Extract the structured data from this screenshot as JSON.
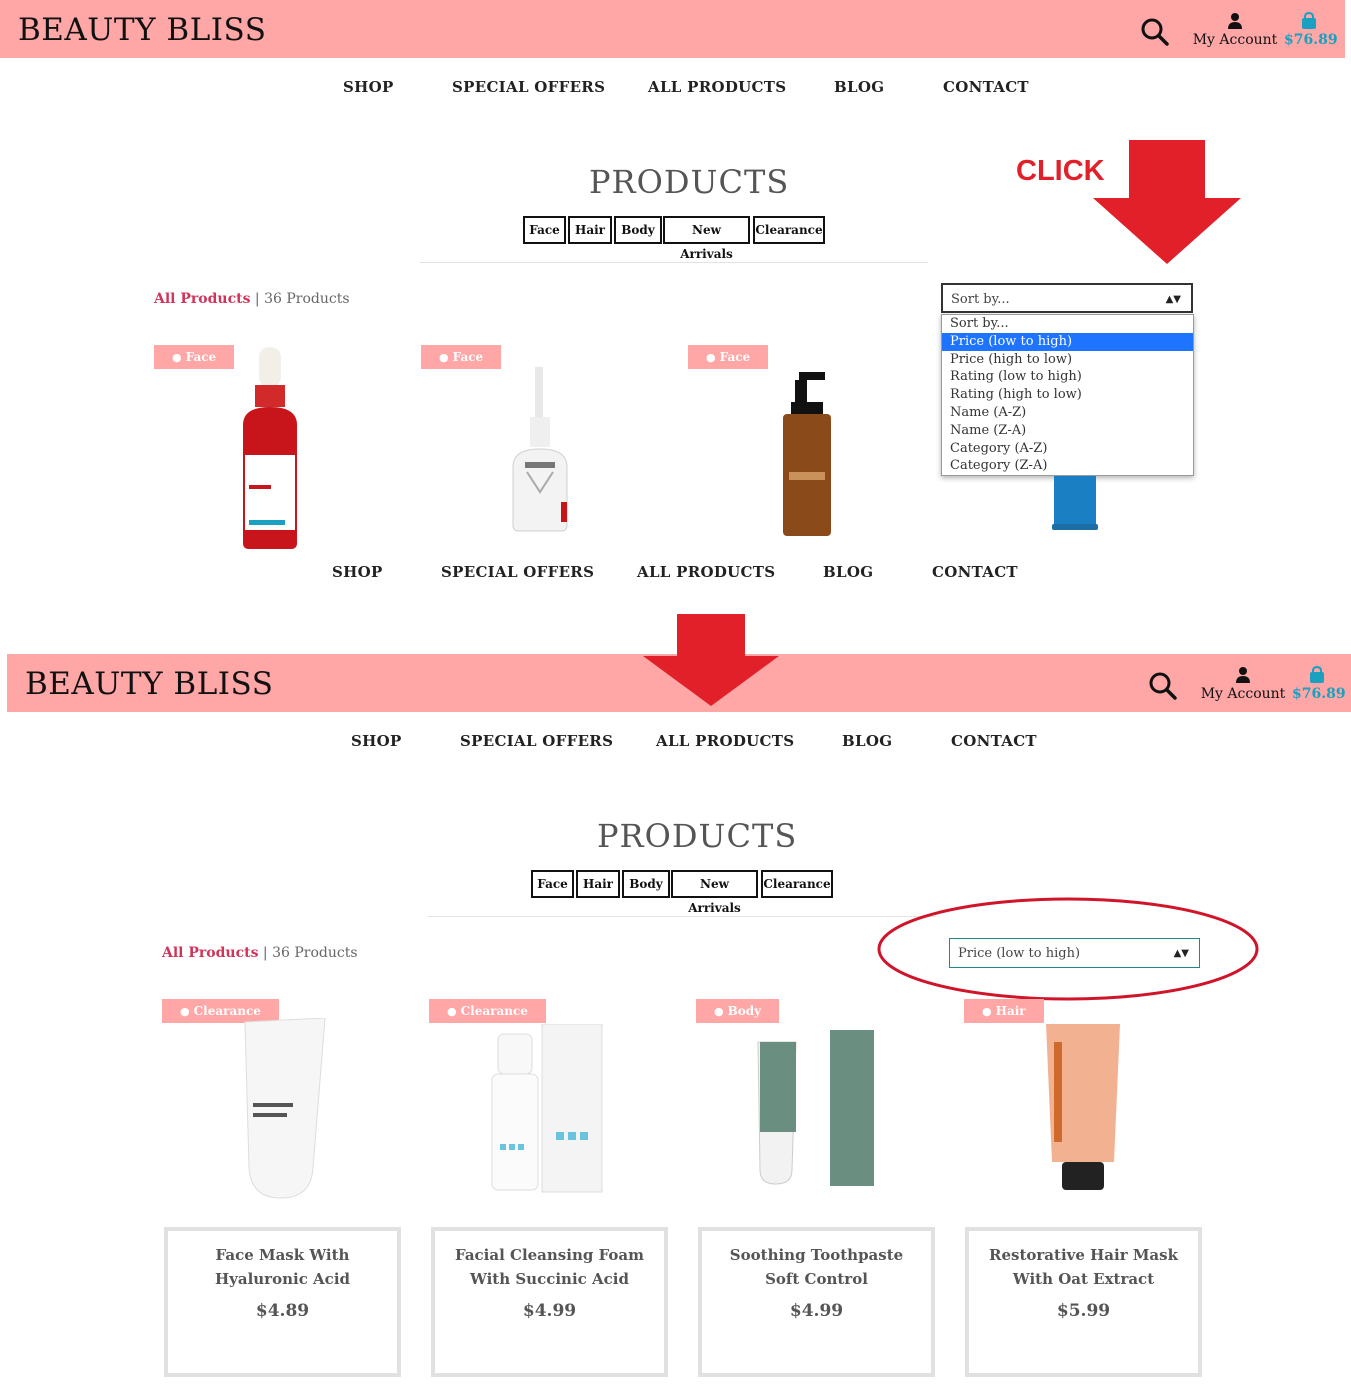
{
  "header": {
    "brand": "BEAUTY BLISS",
    "account_label": "My Account",
    "cart_total": "$76.89"
  },
  "nav": [
    "SHOP",
    "SPECIAL OFFERS",
    "ALL PRODUCTS",
    "BLOG",
    "CONTACT"
  ],
  "page": {
    "title": "PRODUCTS",
    "categories": [
      "Face",
      "Hair",
      "Body",
      "New Arrivals",
      "Clearance"
    ],
    "all_products_link": "All Products",
    "product_count": "| 36 Products"
  },
  "annotation": {
    "click_label": "CLICK"
  },
  "before": {
    "sort_current": "Sort by...",
    "sort_options": [
      "Sort by...",
      "Price (low to high)",
      "Price (high to low)",
      "Rating (low to high)",
      "Rating (high to low)",
      "Name (A-Z)",
      "Name (Z-A)",
      "Category (A-Z)",
      "Category (Z-A)"
    ],
    "highlighted_option": "Price (low to high)",
    "product_tags": [
      "Face",
      "Face",
      "Face"
    ]
  },
  "after": {
    "sort_current": "Price (low to high)",
    "products": [
      {
        "tag": "Clearance",
        "name": "Face Mask With Hyaluronic Acid",
        "price": "$4.89"
      },
      {
        "tag": "Clearance",
        "name": "Facial Cleansing Foam With Succinic Acid",
        "price": "$4.99"
      },
      {
        "tag": "Body",
        "name": "Soothing Toothpaste Soft Control",
        "price": "$4.99"
      },
      {
        "tag": "Hair",
        "name": "Restorative Hair Mask With Oat Extract",
        "price": "$5.99"
      }
    ]
  },
  "colors": {
    "header_bg": "#ffa6a6",
    "accent_link": "#d0345a",
    "cart_color": "#1aa0c0",
    "annotation_red": "#e1202a",
    "selected_option": "#1e74ff"
  }
}
